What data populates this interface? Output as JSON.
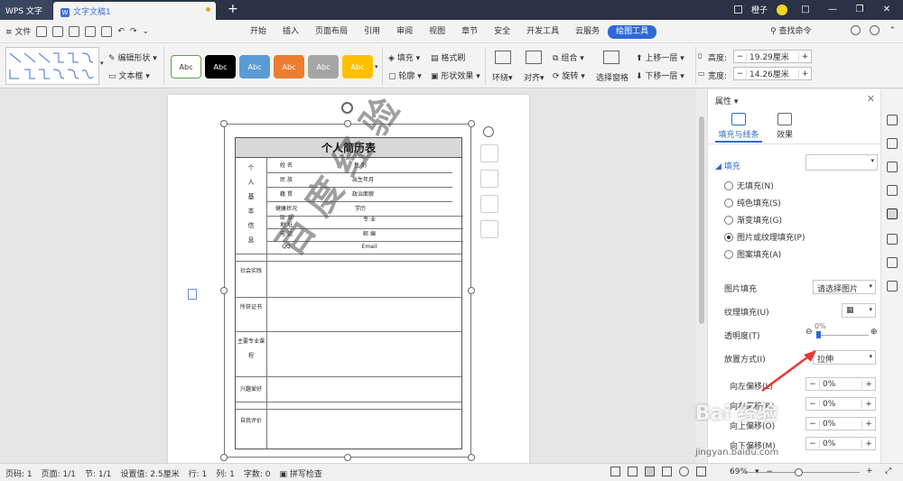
{
  "titlebar": {
    "app_name": "WPS 文字",
    "doc_tab": "文字文稿1",
    "doc_icon": "W",
    "new_tab": "+",
    "user": "橙子",
    "win_tile": "□",
    "win_min": "—",
    "win_max": "❐",
    "win_close": "✕"
  },
  "menubar": {
    "file": "≡ 文件",
    "tabs": [
      "开始",
      "插入",
      "页面布局",
      "引用",
      "审阅",
      "视图",
      "章节",
      "安全",
      "开发工具",
      "云服务",
      "绘图工具"
    ],
    "active_tab": "绘图工具",
    "search": "查找命令"
  },
  "ribbon": {
    "edit_shape": "编辑形状",
    "text_box": "文本框",
    "styles": [
      {
        "label": "Abc",
        "bg": "#ffffff",
        "fg": "#333333",
        "border": "#5aa546"
      },
      {
        "label": "Abc",
        "bg": "#000000",
        "fg": "#ffffff",
        "border": "#000000"
      },
      {
        "label": "Abc",
        "bg": "#5b9bd5",
        "fg": "#ffffff",
        "border": "#5b9bd5"
      },
      {
        "label": "Abc",
        "bg": "#ed7d31",
        "fg": "#ffffff",
        "border": "#ed7d31"
      },
      {
        "label": "Abc",
        "bg": "#a5a5a5",
        "fg": "#ffffff",
        "border": "#a5a5a5"
      },
      {
        "label": "Abc",
        "bg": "#ffc000",
        "fg": "#ffffff",
        "border": "#ffc000"
      }
    ],
    "fill": "填充",
    "outline": "轮廓",
    "format_painter": "格式刷",
    "shape_effect": "形状效果",
    "wrap": "环绕",
    "align": "对齐",
    "group": "组合",
    "rotate": "旋转",
    "selection_pane": "选择窗格",
    "bring_forward": "上移一层",
    "send_backward": "下移一层",
    "height_label": "高度:",
    "height_value": "19.29厘米",
    "width_label": "宽度:",
    "width_value": "14.26厘米"
  },
  "resume": {
    "title": "个人简历表",
    "section_info": [
      "个",
      "人",
      "基",
      "本",
      "信",
      "息"
    ],
    "fields": [
      "姓 名",
      "性 别",
      "民 族",
      "出生年月",
      "籍 贯",
      "政治面貌",
      "健康状况",
      "学历",
      "联 系",
      "地 址",
      "专 业",
      "电 话",
      "邮 编",
      "QQ",
      "Email"
    ],
    "social": "社会实践",
    "awards": "所获证书",
    "courses": "主要专业课程",
    "hobby": "兴趣爱好",
    "self_eval": "自我评价",
    "watermark": "百度经验"
  },
  "panel": {
    "title": "属性",
    "tab_fill": "填充与线条",
    "tab_effect": "效果",
    "fill_section": "填充",
    "options": [
      {
        "label": "无填充(N)",
        "checked": false
      },
      {
        "label": "纯色填充(S)",
        "checked": false
      },
      {
        "label": "渐变填充(G)",
        "checked": false
      },
      {
        "label": "图片或纹理填充(P)",
        "checked": true
      },
      {
        "label": "图案填充(A)",
        "checked": false
      }
    ],
    "picture_fill_label": "图片填充",
    "picture_fill_value": "请选择图片",
    "texture_fill_label": "纹理填充(U)",
    "transparency_label": "透明度(T)",
    "transparency_value": "0%",
    "placement_label": "放置方式(I)",
    "placement_value": "拉伸",
    "offsets": [
      {
        "label": "向左偏移(L)",
        "value": "0%"
      },
      {
        "label": "向右偏移(R)",
        "value": "0%"
      },
      {
        "label": "向上偏移(O)",
        "value": "0%"
      },
      {
        "label": "向下偏移(M)",
        "value": "0%"
      }
    ]
  },
  "statusbar": {
    "page_code": "页码: 1",
    "pages": "页面: 1/1",
    "section": "节: 1/1",
    "setting": "设置值: 2.5厘米",
    "row": "行: 1",
    "col": "列: 1",
    "words": "字数: 0",
    "spell": "拼写检查",
    "zoom": "69%",
    "minus": "−",
    "plus": "+"
  },
  "overlay": {
    "baidu": "Bai 经验",
    "url": "jingyan.baidu.com"
  },
  "colors": {
    "accent": "#2d6ad6",
    "titlebar": "#2b3245",
    "arrow": "#e53935"
  }
}
